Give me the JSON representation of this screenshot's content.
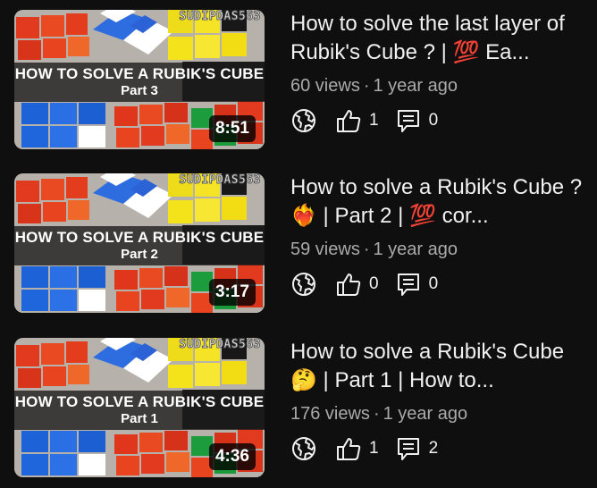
{
  "videos": [
    {
      "thumbnail": {
        "channel_tag": "SUDIPDAS563",
        "banner_line1": "HOW TO SOLVE A RUBIK'S CUBE",
        "banner_line2": "Part 3",
        "duration": "8:51"
      },
      "title": "How to solve the last layer of Rubik's Cube ? | 💯 Ea...",
      "views": "60 views",
      "separator": "·",
      "age": "1 year ago",
      "likes": "1",
      "comments": "0"
    },
    {
      "thumbnail": {
        "channel_tag": "SUDIPDAS563",
        "banner_line1": "HOW TO SOLVE A RUBIK'S CUBE",
        "banner_line2": "Part 2",
        "duration": "3:17"
      },
      "title": "How to solve a Rubik's Cube ?❤️‍🔥 | Part 2 | 💯 cor...",
      "views": "59 views",
      "separator": "·",
      "age": "1 year ago",
      "likes": "0",
      "comments": "0"
    },
    {
      "thumbnail": {
        "channel_tag": "SUDIPDAS563",
        "banner_line1": "HOW TO SOLVE A RUBIK'S CUBE",
        "banner_line2": "Part 1",
        "duration": "4:36"
      },
      "title": "How to solve a Rubik's Cube 🤔 | Part 1 | How to...",
      "views": "176 views",
      "separator": "·",
      "age": "1 year ago",
      "likes": "1",
      "comments": "2"
    }
  ],
  "icons": {
    "visibility": "globe-icon",
    "like": "thumbs-up-icon",
    "comment": "comment-icon"
  },
  "colors": {
    "background": "#0f0f0f",
    "primary_text": "#f1f1f1",
    "secondary_text": "#aaaaaa",
    "duration_badge": "#000000"
  }
}
